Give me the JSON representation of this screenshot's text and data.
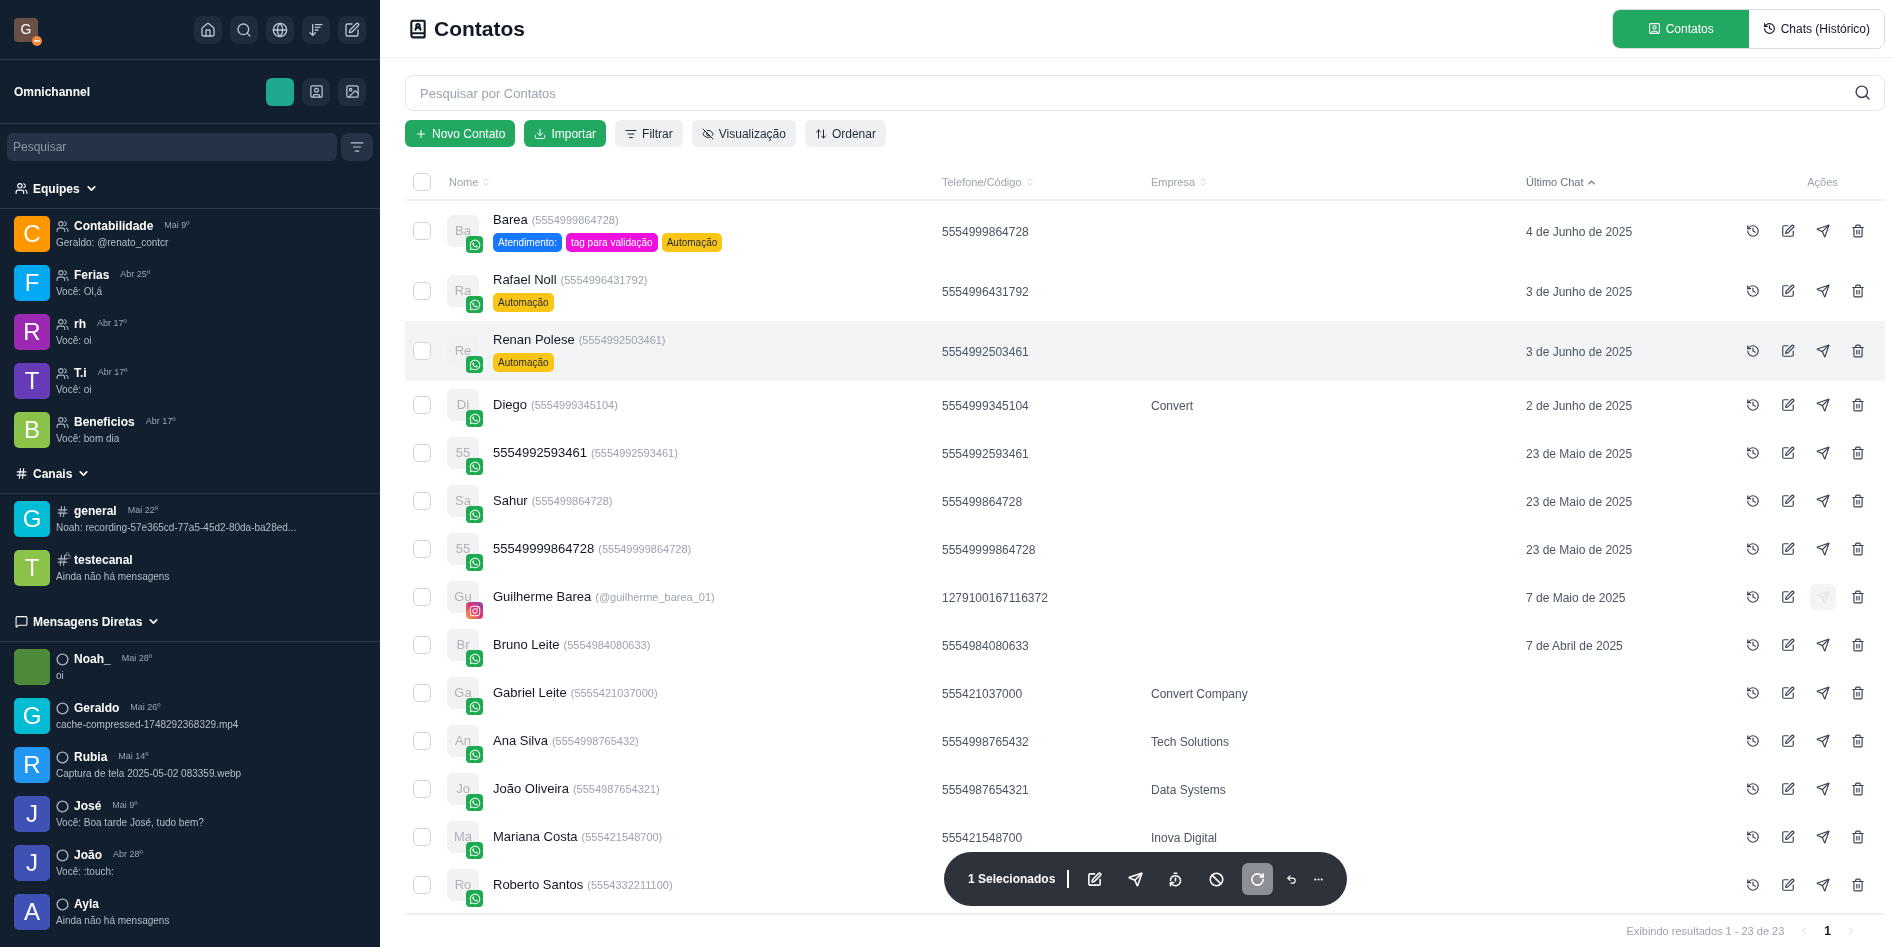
{
  "sidebar": {
    "user_avatar": {
      "letter": "G",
      "busy": true
    },
    "workspace": {
      "title": "Omnichannel"
    },
    "search": {
      "placeholder": "Pesquisar"
    },
    "sections": [
      {
        "kind": "teams",
        "title": "Equipes",
        "expanded": true,
        "items": [
          {
            "kind": "team",
            "name": "Contabilidade",
            "date": "Mai 9º",
            "preview": "Geraldo: @renato_contcr",
            "avatar": {
              "kind": "letter",
              "letter": "C",
              "color": "#ff9800"
            }
          },
          {
            "kind": "team",
            "name": "Ferias",
            "date": "Abr 25º",
            "preview": "Você: Ol,á",
            "avatar": {
              "kind": "letter",
              "letter": "F",
              "color": "#03a9f4"
            }
          },
          {
            "kind": "team",
            "name": "rh",
            "date": "Abr 17º",
            "preview": "Você: oi",
            "avatar": {
              "kind": "letter",
              "letter": "R",
              "color": "#9c27b0"
            }
          },
          {
            "kind": "team",
            "name": "T.i",
            "date": "Abr 17º",
            "preview": "Você: oi",
            "avatar": {
              "kind": "letter",
              "letter": "T",
              "color": "#673ab7"
            }
          },
          {
            "kind": "team",
            "name": "Beneficios",
            "date": "Abr 17º",
            "preview": "Você: bom dia",
            "avatar": {
              "kind": "letter",
              "letter": "B",
              "color": "#8bc34a"
            }
          }
        ]
      },
      {
        "kind": "channels",
        "title": "Canais",
        "expanded": true,
        "items": [
          {
            "kind": "channel",
            "name": "general",
            "date": "Mai 22º",
            "preview": "Noah: recording-57e365cd-77a5-45d2-80da-ba28ed...",
            "avatar": {
              "kind": "letter",
              "letter": "G",
              "color": "#00bcd4"
            }
          },
          {
            "kind": "private_channel",
            "name": "testecanal",
            "preview": "Ainda não há mensagens",
            "avatar": {
              "kind": "letter",
              "letter": "T",
              "color": "#8bc34a"
            }
          }
        ]
      },
      {
        "kind": "direct",
        "title": "Mensagens Diretas",
        "expanded": true,
        "items": [
          {
            "kind": "direct",
            "name": "Noah_",
            "date": "Mai 28º",
            "preview": "oi",
            "avatar": {
              "kind": "picture"
            }
          },
          {
            "kind": "direct",
            "name": "Geraldo",
            "date": "Mai 26º",
            "preview": "cache-compressed-1748292368329.mp4",
            "avatar": {
              "kind": "letter",
              "letter": "G",
              "color": "#00bcd4"
            }
          },
          {
            "kind": "direct",
            "name": "Rubia",
            "date": "Mai 14º",
            "preview": "Captura de tela 2025-05-02 083359.webp",
            "avatar": {
              "kind": "letter",
              "letter": "R",
              "color": "#2196f3"
            }
          },
          {
            "kind": "direct",
            "name": "José",
            "date": "Mai 9º",
            "preview": "Você: Boa tarde José, tudo bem?",
            "avatar": {
              "kind": "letter",
              "letter": "J",
              "color": "#3f51b5"
            }
          },
          {
            "kind": "direct",
            "name": "João",
            "date": "Abr 28º",
            "preview": "Você: :touch:",
            "avatar": {
              "kind": "letter",
              "letter": "J",
              "color": "#3f51b5"
            }
          },
          {
            "kind": "direct",
            "name": "Ayla",
            "preview": "Ainda não há mensagens",
            "avatar": {
              "kind": "letter",
              "letter": "A",
              "color": "#3f51b5"
            }
          }
        ]
      }
    ]
  },
  "page": {
    "title": "Contatos",
    "view_tabs": [
      {
        "label": "Contatos",
        "selected": true
      },
      {
        "label": "Chats (Histórico)",
        "selected": false
      }
    ],
    "search": {
      "placeholder": "Pesquisar por Contatos"
    },
    "toolbar": [
      {
        "kind": "new",
        "label": "Novo Contato"
      },
      {
        "kind": "import",
        "label": "Importar"
      },
      {
        "kind": "filter",
        "label": "Filtrar"
      },
      {
        "kind": "view",
        "label": "Visualização"
      },
      {
        "kind": "sort",
        "label": "Ordenar"
      }
    ]
  },
  "table": {
    "select_all_checked": false,
    "columns": [
      {
        "label": "Nome",
        "sortable": true,
        "sorted": false
      },
      {
        "label": "Telefone/Código",
        "sortable": true,
        "sorted": false
      },
      {
        "label": "Empresa",
        "sortable": true,
        "sorted": false
      },
      {
        "label": "Último Chat",
        "sortable": true,
        "sorted": true
      },
      {
        "label": "Ações",
        "sortable": false
      }
    ],
    "rows": [
      {
        "initials": "Ba",
        "kind": "whatsapp",
        "name": "Barea",
        "handle": "(5554999864728)",
        "tags": [
          {
            "label": "Atendimento:",
            "color": "#1677ff"
          },
          {
            "label": "tag para validação",
            "color": "#ee11dd"
          },
          {
            "label": "Automação",
            "color": "#fbc515"
          }
        ],
        "phone": "5554999864728",
        "company": "",
        "last_chat": "4 de Junho de 2025",
        "checked": false,
        "highlighted": false,
        "send_disabled": false
      },
      {
        "initials": "Ra",
        "kind": "whatsapp",
        "name": "Rafael Noll",
        "handle": "(5554996431792)",
        "tags": [
          {
            "label": "Automação",
            "color": "#fbc515"
          }
        ],
        "phone": "5554996431792",
        "company": "",
        "last_chat": "3 de Junho de 2025",
        "checked": false,
        "highlighted": false,
        "send_disabled": false
      },
      {
        "initials": "Re",
        "kind": "whatsapp",
        "name": "Renan Polese",
        "handle": "(5554992503461)",
        "tags": [
          {
            "label": "Automação",
            "color": "#fbc515"
          }
        ],
        "phone": "5554992503461",
        "company": "",
        "last_chat": "3 de Junho de 2025",
        "checked": false,
        "highlighted": true,
        "send_disabled": false
      },
      {
        "initials": "Di",
        "kind": "whatsapp",
        "name": "Diego",
        "handle": "(5554999345104)",
        "tags": [],
        "phone": "5554999345104",
        "company": "Convert",
        "last_chat": "2 de Junho de 2025",
        "checked": false,
        "highlighted": false,
        "send_disabled": false
      },
      {
        "initials": "55",
        "kind": "whatsapp",
        "name": "5554992593461",
        "handle": "(5554992593461)",
        "tags": [],
        "phone": "5554992593461",
        "company": "",
        "last_chat": "23 de Maio de 2025",
        "checked": false,
        "highlighted": false,
        "send_disabled": false
      },
      {
        "initials": "Sa",
        "kind": "whatsapp",
        "name": "Sahur",
        "handle": "(555499864728)",
        "tags": [],
        "phone": "555499864728",
        "company": "",
        "last_chat": "23 de Maio de 2025",
        "checked": false,
        "highlighted": false,
        "send_disabled": false
      },
      {
        "initials": "55",
        "kind": "whatsapp",
        "name": "55549999864728",
        "handle": "(55549999864728)",
        "tags": [],
        "phone": "55549999864728",
        "company": "",
        "last_chat": "23 de Maio de 2025",
        "checked": false,
        "highlighted": false,
        "send_disabled": false
      },
      {
        "initials": "Gu",
        "kind": "instagram",
        "name": "Guilherme Barea",
        "handle": "(@guilherme_barea_01)",
        "tags": [],
        "phone": "1279100167116372",
        "company": "",
        "last_chat": "7 de Maio de 2025",
        "checked": false,
        "highlighted": false,
        "send_disabled": true
      },
      {
        "initials": "Br",
        "kind": "whatsapp",
        "name": "Bruno Leite",
        "handle": "(5554984080633)",
        "tags": [],
        "phone": "5554984080633",
        "company": "",
        "last_chat": "7 de Abril de 2025",
        "checked": false,
        "highlighted": false,
        "send_disabled": false
      },
      {
        "initials": "Ga",
        "kind": "whatsapp",
        "name": "Gabriel Leite",
        "handle": "(5555421037000)",
        "tags": [],
        "phone": "555421037000",
        "company": "Convert Company",
        "last_chat": "",
        "checked": false,
        "highlighted": false,
        "send_disabled": false
      },
      {
        "initials": "An",
        "kind": "whatsapp",
        "name": "Ana Silva",
        "handle": "(5554998765432)",
        "tags": [],
        "phone": "5554998765432",
        "company": "Tech Solutions",
        "last_chat": "",
        "checked": false,
        "highlighted": false,
        "send_disabled": false
      },
      {
        "initials": "Jo",
        "kind": "whatsapp",
        "name": "João Oliveira",
        "handle": "(5554987654321)",
        "tags": [],
        "phone": "5554987654321",
        "company": "Data Systems",
        "last_chat": "",
        "checked": false,
        "highlighted": false,
        "send_disabled": false
      },
      {
        "initials": "Ma",
        "kind": "whatsapp",
        "name": "Mariana Costa",
        "handle": "(555421548700)",
        "tags": [],
        "phone": "555421548700",
        "company": "Inova Digital",
        "last_chat": "",
        "checked": false,
        "highlighted": false,
        "send_disabled": false
      },
      {
        "initials": "Ro",
        "kind": "whatsapp",
        "name": "Roberto Santos",
        "handle": "(5554332211100)",
        "tags": [],
        "phone": "",
        "company": "",
        "last_chat": "",
        "checked": false,
        "highlighted": false,
        "send_disabled": false
      }
    ]
  },
  "selection_bar": {
    "label": "1 Selecionados",
    "actions": [
      {
        "kind": "edit",
        "active": false
      },
      {
        "kind": "send",
        "active": false
      },
      {
        "kind": "timer",
        "active": false
      },
      {
        "kind": "block",
        "active": false
      },
      {
        "kind": "reopen",
        "active": true
      },
      {
        "kind": "undo",
        "active": false
      },
      {
        "kind": "more",
        "active": false
      }
    ]
  },
  "pagination": {
    "summary": "Exibindo resultados 1 - 23 de 23",
    "pages": [
      {
        "label": "1",
        "selected": true
      }
    ]
  }
}
